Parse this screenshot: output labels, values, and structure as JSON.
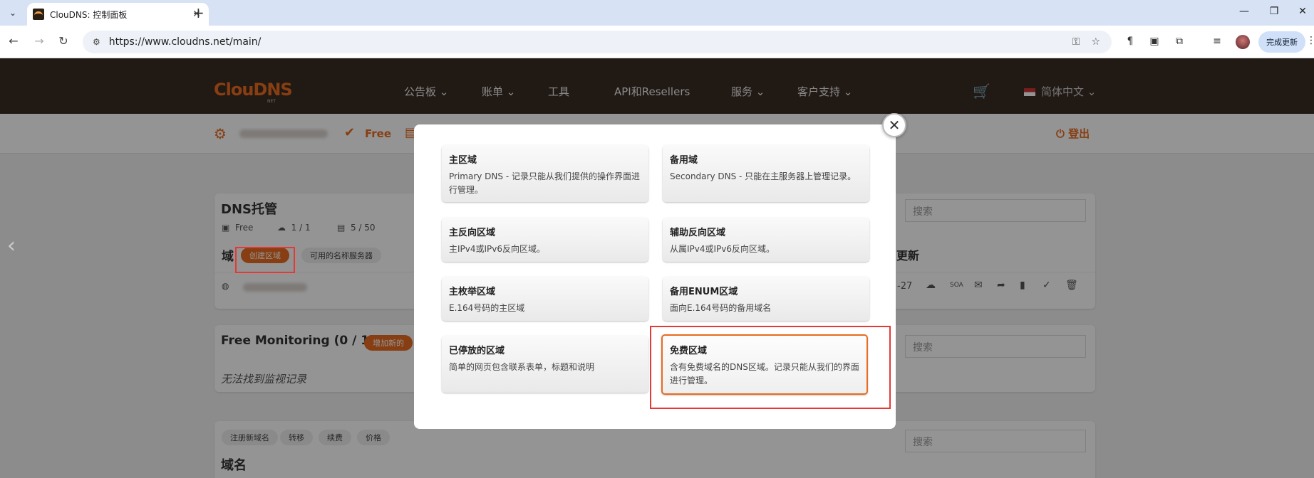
{
  "browser": {
    "tab_title": "ClouDNS: 控制面板",
    "url": "https://www.cloudns.net/main/",
    "update_label": "完成更新"
  },
  "site": {
    "logo": "ClouDNS",
    "logo_sub": "NET",
    "nav": [
      "公告板",
      "账单",
      "工具",
      "API和Resellers",
      "服务",
      "客户支持"
    ],
    "language": "简体中文",
    "sub_free": "Free",
    "logout": "登出"
  },
  "dns_card": {
    "title": "DNS托管",
    "plan": "Free",
    "zones_count": "1 / 1",
    "records_count": "5 / 50",
    "section_label": "域",
    "create_zone": "创建区域",
    "nameservers": "可用的名称服务器",
    "search_placeholder": "搜索",
    "last_update_header": "更新",
    "date_fragment": "-27"
  },
  "monitoring_card": {
    "title": "Free Monitoring (0 / 1)",
    "add_label": "增加新的",
    "empty_text": "无法找到监视记录",
    "search_placeholder": "搜索"
  },
  "domains_card": {
    "tabs": [
      "注册新域名",
      "转移",
      "续费",
      "价格"
    ],
    "title": "域名",
    "search_placeholder": "搜索"
  },
  "modal": {
    "options": [
      {
        "title": "主区域",
        "desc": "Primary DNS - 记录只能从我们提供的操作界面进行管理。"
      },
      {
        "title": "备用域",
        "desc": "Secondary DNS - 只能在主服务器上管理记录。"
      },
      {
        "title": "主反向区域",
        "desc": "主IPv4或IPv6反向区域。"
      },
      {
        "title": "辅助反向区域",
        "desc": "从属IPv4或IPv6反向区域。"
      },
      {
        "title": "主枚举区域",
        "desc": "E.164号码的主区域"
      },
      {
        "title": "备用ENUM区域",
        "desc": "面向E.164号码的备用域名"
      },
      {
        "title": "已停放的区域",
        "desc": "简单的网页包含联系表单，标题和说明"
      },
      {
        "title": "免费区域",
        "desc": "含有免费域名的DNS区域。记录只能从我们的界面进行管理。"
      }
    ],
    "selected_index": 7
  },
  "colors": {
    "accent": "#e86b1f",
    "highlight": "#e53935",
    "header_bg": "#3a2c24"
  }
}
